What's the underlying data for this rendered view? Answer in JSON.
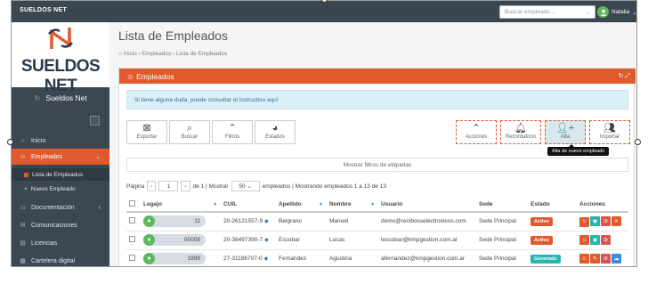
{
  "topbar": {
    "brand": "SUELDOS NET",
    "search_placeholder": "Buscar empleado...",
    "user": "Natalia"
  },
  "sidebar": {
    "logo_text": "SUELDOS NET",
    "app_name": "Sueldos Net",
    "items": [
      {
        "label": "Inicio"
      },
      {
        "label": "Empleados"
      },
      {
        "label": "Lista de Empleados"
      },
      {
        "label": "Nuevo Empleado"
      },
      {
        "label": "Documentación"
      },
      {
        "label": "Comunicaciones"
      },
      {
        "label": "Licencias"
      },
      {
        "label": "Cartelera digital"
      }
    ]
  },
  "page": {
    "title": "Lista de Empleados",
    "breadcrumb": [
      "Inicio",
      "Empleados",
      "Lista de Empleados"
    ]
  },
  "panel": {
    "title": "Empleados",
    "info_text": "Si tiene alguna duda, puede consultar el instructivo",
    "info_link": "aquí",
    "toolbar": {
      "exportar": "Exportar",
      "buscar": "Buscar",
      "filtros": "Filtros",
      "estados": "Estados",
      "acciones": "Acciones",
      "recordatorio": "Recordatorio",
      "alta": "Alta",
      "importar": "Importar"
    },
    "tooltip": "Alta de nuevo empleado",
    "filters_label": "Mostrar filtros de etiquetas"
  },
  "pager": {
    "pagina": "Página",
    "page": "1",
    "de": "de 1 | Mostrar",
    "per_page": "50",
    "summary": "empleados | Mostrando empleados 1 a 13 de 13"
  },
  "table": {
    "columns": [
      "Legajo",
      "CUIL",
      "Apellido",
      "Nombre",
      "Usuario",
      "Sede",
      "Estado",
      "Acciones"
    ],
    "rows": [
      {
        "legajo": "11",
        "cuil": "20-26121557-9",
        "apellido": "Belgrano",
        "nombre": "Manuel",
        "usuario": "demo@recibosselectronicos.com",
        "sede": "Sede Principal",
        "estado": "Activo"
      },
      {
        "legajo": "00008",
        "cuil": "20-38497390-7",
        "apellido": "Escobar",
        "nombre": "Lucas",
        "usuario": "lescobar@kmpgestion.com.ar",
        "sede": "Sede Principal",
        "estado": "Activo"
      },
      {
        "legajo": "1999",
        "cuil": "27-31186707-0",
        "apellido": "Fernandez",
        "nombre": "Agustina",
        "usuario": "afernandez@kmpgestion.com.ar",
        "sede": "Sede Principal",
        "estado": "Generado"
      }
    ]
  },
  "colors": {
    "accent": "#e05a2e",
    "sidebar": "#3b4752",
    "teal": "#2ab3b0",
    "green": "#5cb85c"
  }
}
